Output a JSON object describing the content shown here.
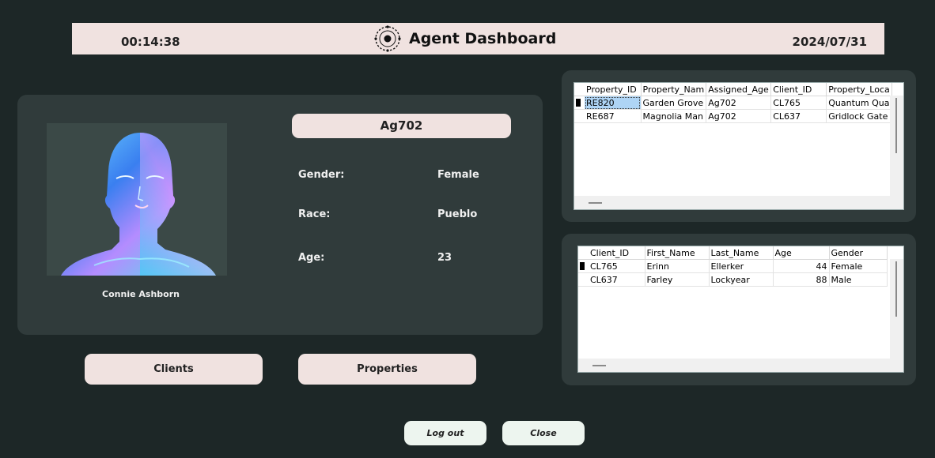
{
  "header": {
    "time": "00:14:38",
    "title": "Agent Dashboard",
    "date": "2024/07/31"
  },
  "agent": {
    "id": "Ag702",
    "name": "Connie Ashborn",
    "fields": [
      {
        "label": "Gender:",
        "value": "Female"
      },
      {
        "label": "Race:",
        "value": "Pueblo"
      },
      {
        "label": "Age:",
        "value": "23"
      }
    ]
  },
  "actions": {
    "clients": "Clients",
    "properties": "Properties",
    "logout": "Log out",
    "close": "Close"
  },
  "properties_table": {
    "columns": [
      "Property_ID",
      "Property_Nam",
      "Assigned_Age",
      "Client_ID",
      "Property_Loca"
    ],
    "rows": [
      [
        "RE820",
        "Garden Grove",
        "Ag702",
        "CL765",
        "Quantum Qua"
      ],
      [
        "RE687",
        "Magnolia Man",
        "Ag702",
        "CL637",
        "Gridlock Gate"
      ]
    ]
  },
  "clients_table": {
    "columns": [
      "Client_ID",
      "First_Name",
      "Last_Name",
      "Age",
      "Gender"
    ],
    "rows": [
      [
        "CL765",
        "Erinn",
        "Ellerker",
        "44",
        "Female"
      ],
      [
        "CL637",
        "Farley",
        "Lockyear",
        "88",
        "Male"
      ]
    ]
  },
  "colors": {
    "background": "#1d2727",
    "panel": "#303b3b",
    "pill": "#f0e2e0",
    "selection": "#aed4f5"
  },
  "icons": {
    "logo": "radar-target-icon"
  }
}
